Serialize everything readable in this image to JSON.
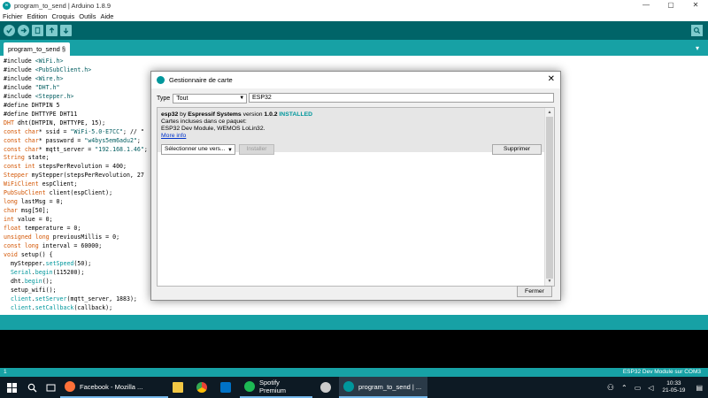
{
  "window": {
    "title": "program_to_send | Arduino 1.8.9",
    "minimize": "—",
    "maximize": "▢",
    "close": "✕"
  },
  "menu": [
    "Fichier",
    "Edition",
    "Croquis",
    "Outils",
    "Aide"
  ],
  "toolbar": {
    "buttons": [
      "verify-icon",
      "upload-icon",
      "new-icon",
      "open-icon",
      "save-icon"
    ],
    "serial_monitor": "serial-monitor-icon"
  },
  "tab": {
    "label": "program_to_send §",
    "menu_glyph": "▾"
  },
  "code": [
    "#include <WiFi.h>",
    "#include <PubSubClient.h>",
    "#include <Wire.h>",
    "#include \"DHT.h\"",
    "#include <Stepper.h>",
    "#define DHTPIN 5",
    "#define DHTTYPE DHT11",
    "DHT dht(DHTPIN, DHTTYPE, 15);",
    "const char* ssid = \"WiFi-5.0-E7CC\"; // \"",
    "const char* password = \"w4bys5em6adu2\";",
    "const char* mqtt_server = \"192.168.1.46\";",
    "String state;",
    "const int stepsPerRevolution = 400;",
    "Stepper myStepper(stepsPerRevolution, 27",
    "WiFiClient espClient;",
    "PubSubClient client(espClient);",
    "long lastMsg = 0;",
    "char msg[50];",
    "int value = 0;",
    "float temperature = 0;",
    "unsigned long previousMillis = 0;",
    "const long interval = 60000;",
    "void setup() {",
    "  myStepper.setSpeed(50);",
    "  Serial.begin(115200);",
    "  dht.begin();",
    "  setup_wifi();",
    "  client.setServer(mqtt_server, 1883);",
    "  client.setCallback(callback);"
  ],
  "status": {
    "line": "1",
    "board": "ESP32 Dev Module sur COM3"
  },
  "dialog": {
    "title": "Gestionnaire de carte",
    "type_label": "Type",
    "type_value": "Tout",
    "search_value": "ESP32",
    "package": {
      "name": "esp32",
      "by": "by",
      "author": "Espressif Systems",
      "version_label": "version",
      "version": "1.0.2",
      "installed": "INSTALLED",
      "included_label": "Cartes incluses dans ce paquet:",
      "boards": "ESP32 Dev Module, WEMOS LoLin32.",
      "more_info": "More info"
    },
    "version_select": "Sélectionner une vers...",
    "install": "Installer",
    "remove": "Supprimer",
    "close": "Fermer"
  },
  "taskbar": {
    "items": [
      {
        "label": "Facebook - Mozilla ...",
        "icon": "firefox-icon",
        "color": "#ff7139"
      },
      {
        "label": "",
        "icon": "task-view-icon",
        "color": "#ffffff"
      },
      {
        "label": "",
        "icon": "chrome-icon",
        "color": "#4caf50"
      },
      {
        "label": "",
        "icon": "outlook-icon",
        "color": "#0072c6"
      },
      {
        "label": "Spotify Premium",
        "icon": "spotify-icon",
        "color": "#1db954"
      },
      {
        "label": "",
        "icon": "app-icon",
        "color": "#cccccc"
      },
      {
        "label": "program_to_send | ...",
        "icon": "arduino-icon",
        "color": "#00979c"
      }
    ],
    "time": "10:33",
    "date": "21-05-19"
  },
  "colors": {
    "arduino_teal": "#00979c",
    "toolbar_dark": "#006468",
    "tab_strip": "#17a1a5",
    "installed": "#00979c"
  }
}
